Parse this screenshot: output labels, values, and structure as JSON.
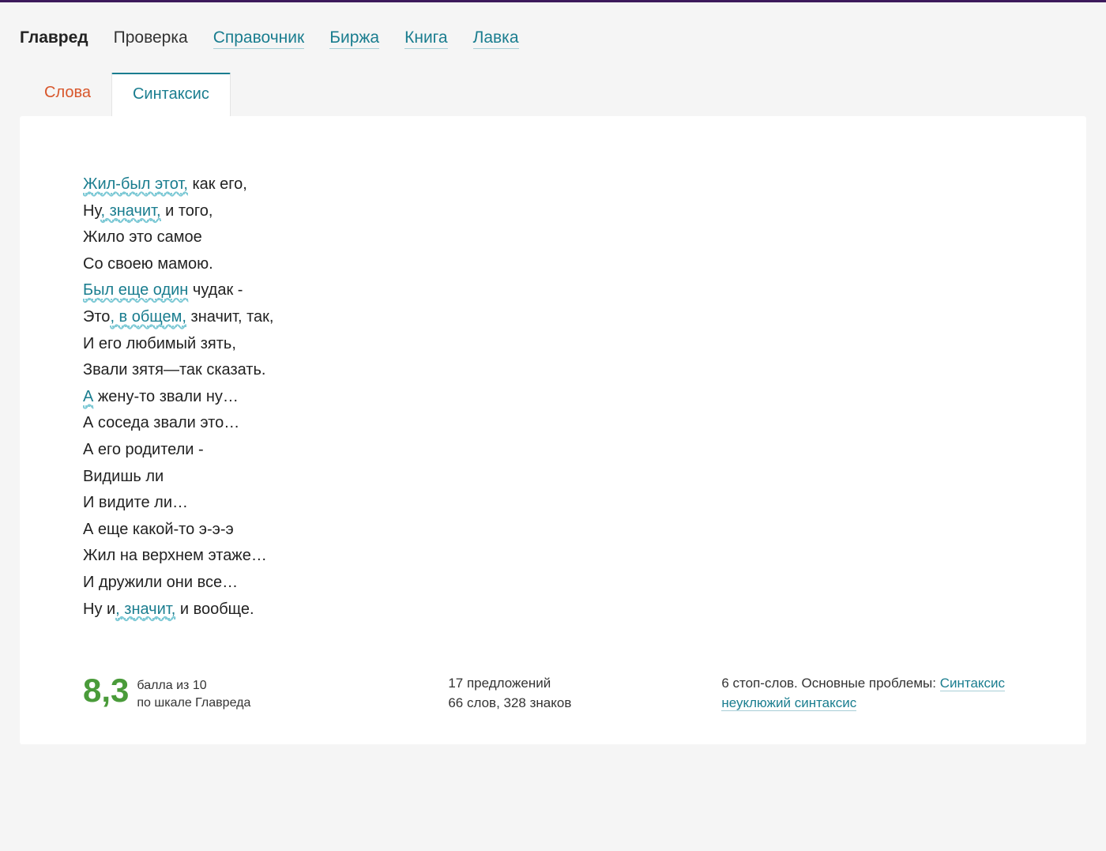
{
  "header": {
    "brand": "Главред",
    "nav": {
      "check": "Проверка",
      "reference": "Справочник",
      "exchange": "Биржа",
      "book": "Книга",
      "shop": "Лавка"
    }
  },
  "tabs": {
    "words": "Слова",
    "syntax": "Синтаксис"
  },
  "text": {
    "lines": [
      {
        "pre": "",
        "hl": "Жил-был этот,",
        "post": " как его,"
      },
      {
        "pre": "Ну",
        "hl": ", значит,",
        "post": " и того,"
      },
      {
        "pre": "Жило это самое",
        "hl": "",
        "post": ""
      },
      {
        "pre": "Со своею мамою.",
        "hl": "",
        "post": ""
      },
      {
        "pre": "",
        "hl": "Был еще один",
        "post": " чудак -"
      },
      {
        "pre": "Это",
        "hl": ", в общем,",
        "post": " значит, так,"
      },
      {
        "pre": "И его любимый зять,",
        "hl": "",
        "post": ""
      },
      {
        "pre": "Звали зятя—так сказать.",
        "hl": "",
        "post": ""
      },
      {
        "pre": "",
        "hl": "А",
        "post": " жену-то звали ну…"
      },
      {
        "pre": "А соседа звали это…",
        "hl": "",
        "post": ""
      },
      {
        "pre": "А его родители -",
        "hl": "",
        "post": ""
      },
      {
        "pre": "Видишь ли",
        "hl": "",
        "post": ""
      },
      {
        "pre": "И видите ли…",
        "hl": "",
        "post": ""
      },
      {
        "pre": "А еще какой-то э-э-э",
        "hl": "",
        "post": ""
      },
      {
        "pre": "Жил на верхнем этаже…",
        "hl": "",
        "post": ""
      },
      {
        "pre": "И дружили они все…",
        "hl": "",
        "post": ""
      },
      {
        "pre": "Ну и",
        "hl": ", значит,",
        "post": " и вообще."
      }
    ]
  },
  "stats": {
    "score": "8,3",
    "score_max_label": "балла из 10",
    "score_scale_label": "по шкале Главреда",
    "sentences": "17 предложений",
    "words_chars": "66 слов, 328 знаков",
    "stop_words_prefix": "6 стоп-слов. Основные проблемы: ",
    "problem_syntax": "Синтаксис",
    "problem_clumsy": "неуклюжий синтаксис"
  }
}
